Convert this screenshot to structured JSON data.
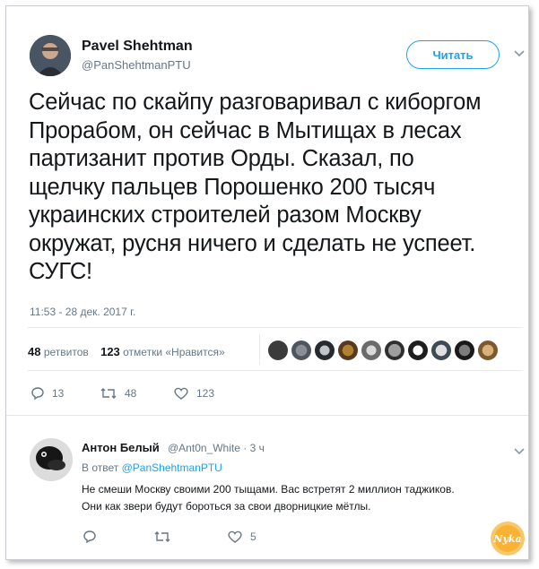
{
  "tweet": {
    "author_name": "Pavel Shehtman",
    "author_handle": "@PanShehtmanPTU",
    "follow_label": "Читать",
    "text": "Сейчас по скайпу разговаривал с киборгом\nПрорабом, он сейчас в Мытищах в лесах\nпартизанит против Орды. Сказал, по\nщелчку пальцев Порошенко 200 тысяч\nукраинских строителей разом Москву\nокружат, русня ничего и сделать не успеет.\nСУГС!",
    "timestamp": "11:53 - 28 дек. 2017 г."
  },
  "stats": {
    "retweets_count": "48",
    "retweets_label": "ретвитов",
    "likes_count": "123",
    "likes_label": "отметки «Нравится»"
  },
  "actions": {
    "reply_count": "13",
    "retweet_count": "48",
    "like_count": "123"
  },
  "reply": {
    "author_name": "Антон Белый",
    "author_handle": "@Ant0n_White",
    "time": "· 3 ч",
    "reply_to_prefix": "В ответ",
    "reply_to_handle": "@PanShehtmanPTU",
    "text": "Не смеши Москву своими 200 тыщами. Вас встретят 2 миллион таджиков.\nОни как звери будут бороться за свои дворницкие мётлы.",
    "like_count": "5"
  },
  "watermark": {
    "text": "Nyka"
  },
  "colors": {
    "accent": "#1da1f2",
    "muted": "#657786",
    "text": "#14171a",
    "divider": "#e6ecf0"
  }
}
